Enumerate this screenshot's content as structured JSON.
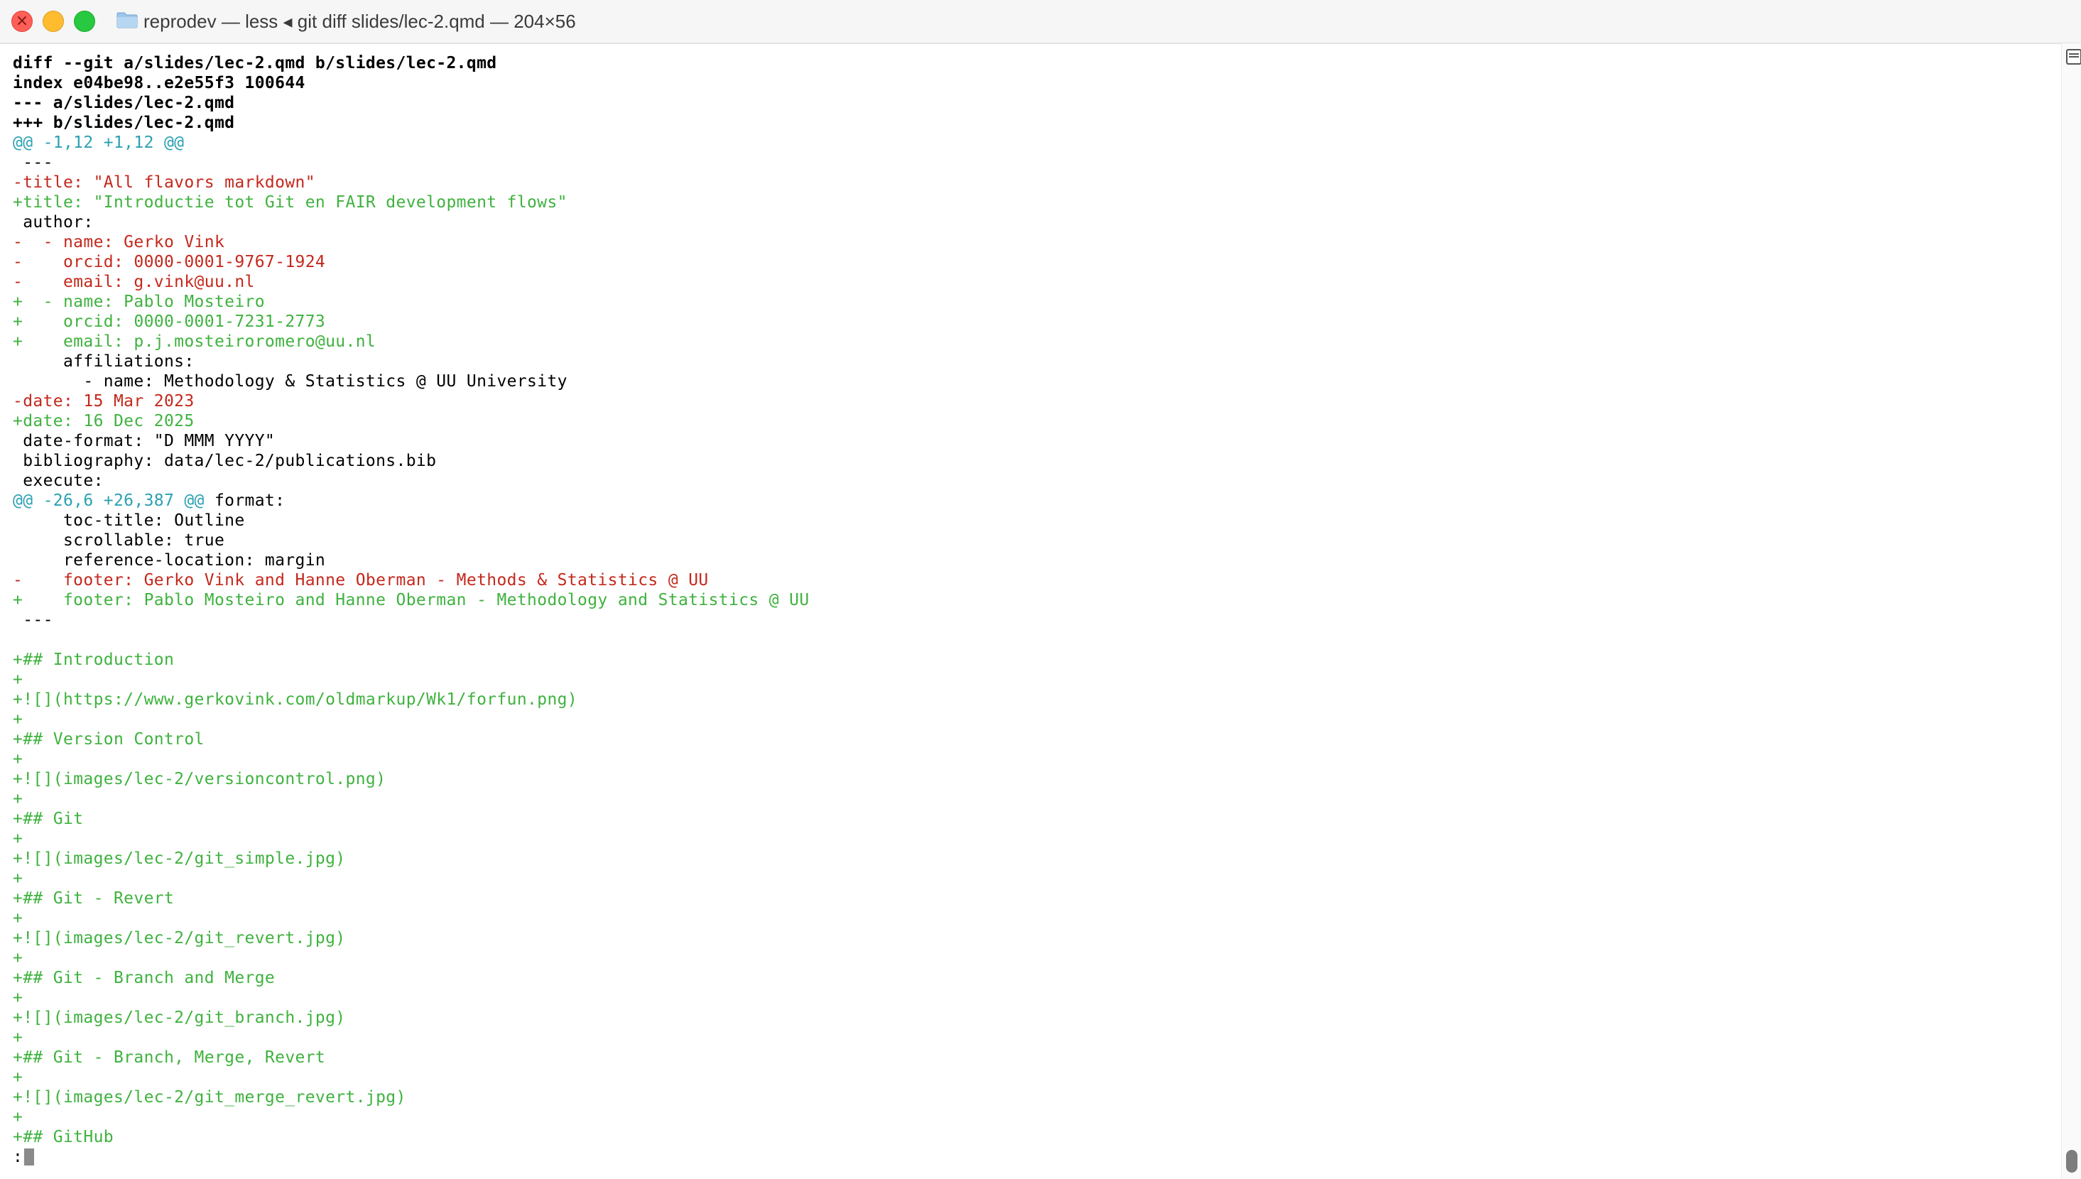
{
  "window": {
    "title": "reprodev — less ◂ git diff slides/lec-2.qmd — 204×56"
  },
  "diff": {
    "lines": [
      {
        "kind": "meta",
        "text": "diff --git a/slides/lec-2.qmd b/slides/lec-2.qmd"
      },
      {
        "kind": "meta",
        "text": "index e04be98..e2e55f3 100644"
      },
      {
        "kind": "meta",
        "text": "--- a/slides/lec-2.qmd"
      },
      {
        "kind": "meta",
        "text": "+++ b/slides/lec-2.qmd"
      },
      {
        "kind": "hunk",
        "text": "@@ -1,12 +1,12 @@"
      },
      {
        "kind": "ctx",
        "text": " ---"
      },
      {
        "kind": "del",
        "text": "-title: \"All flavors markdown\""
      },
      {
        "kind": "add",
        "text": "+title: \"Introductie tot Git en FAIR development flows\""
      },
      {
        "kind": "ctx",
        "text": " author:"
      },
      {
        "kind": "del",
        "text": "-  - name: Gerko Vink"
      },
      {
        "kind": "del",
        "text": "-    orcid: 0000-0001-9767-1924"
      },
      {
        "kind": "del",
        "text": "-    email: g.vink@uu.nl"
      },
      {
        "kind": "add",
        "text": "+  - name: Pablo Mosteiro"
      },
      {
        "kind": "add",
        "text": "+    orcid: 0000-0001-7231-2773"
      },
      {
        "kind": "add",
        "text": "+    email: p.j.mosteiroromero@uu.nl"
      },
      {
        "kind": "ctx",
        "text": "     affiliations:"
      },
      {
        "kind": "ctx",
        "text": "       - name: Methodology & Statistics @ UU University"
      },
      {
        "kind": "del",
        "text": "-date: 15 Mar 2023"
      },
      {
        "kind": "add",
        "text": "+date: 16 Dec 2025"
      },
      {
        "kind": "ctx",
        "text": " date-format: \"D MMM YYYY\""
      },
      {
        "kind": "ctx",
        "text": " bibliography: data/lec-2/publications.bib"
      },
      {
        "kind": "ctx",
        "text": " execute:"
      },
      {
        "kind": "hunkctx",
        "hunk": "@@ -26,6 +26,387 @@",
        "text": " format:"
      },
      {
        "kind": "ctx",
        "text": "     toc-title: Outline"
      },
      {
        "kind": "ctx",
        "text": "     scrollable: true"
      },
      {
        "kind": "ctx",
        "text": "     reference-location: margin"
      },
      {
        "kind": "del",
        "text": "-    footer: Gerko Vink and Hanne Oberman - Methods & Statistics @ UU"
      },
      {
        "kind": "add",
        "text": "+    footer: Pablo Mosteiro and Hanne Oberman - Methodology and Statistics @ UU"
      },
      {
        "kind": "ctx",
        "text": " ---"
      },
      {
        "kind": "ctx",
        "text": ""
      },
      {
        "kind": "add",
        "text": "+## Introduction"
      },
      {
        "kind": "add",
        "text": "+"
      },
      {
        "kind": "add",
        "text": "+![](https://www.gerkovink.com/oldmarkup/Wk1/forfun.png)"
      },
      {
        "kind": "add",
        "text": "+"
      },
      {
        "kind": "add",
        "text": "+## Version Control"
      },
      {
        "kind": "add",
        "text": "+"
      },
      {
        "kind": "add",
        "text": "+![](images/lec-2/versioncontrol.png)"
      },
      {
        "kind": "add",
        "text": "+"
      },
      {
        "kind": "add",
        "text": "+## Git"
      },
      {
        "kind": "add",
        "text": "+"
      },
      {
        "kind": "add",
        "text": "+![](images/lec-2/git_simple.jpg)"
      },
      {
        "kind": "add",
        "text": "+"
      },
      {
        "kind": "add",
        "text": "+## Git - Revert"
      },
      {
        "kind": "add",
        "text": "+"
      },
      {
        "kind": "add",
        "text": "+![](images/lec-2/git_revert.jpg)"
      },
      {
        "kind": "add",
        "text": "+"
      },
      {
        "kind": "add",
        "text": "+## Git - Branch and Merge"
      },
      {
        "kind": "add",
        "text": "+"
      },
      {
        "kind": "add",
        "text": "+![](images/lec-2/git_branch.jpg)"
      },
      {
        "kind": "add",
        "text": "+"
      },
      {
        "kind": "add",
        "text": "+## Git - Branch, Merge, Revert"
      },
      {
        "kind": "add",
        "text": "+"
      },
      {
        "kind": "add",
        "text": "+![](images/lec-2/git_merge_revert.jpg)"
      },
      {
        "kind": "add",
        "text": "+"
      },
      {
        "kind": "add",
        "text": "+## GitHub"
      }
    ],
    "prompt": ":"
  },
  "colors": {
    "added": "#3fb23f",
    "removed": "#c4281c",
    "hunk": "#2aa1b3",
    "context": "#000000"
  },
  "icons": [
    "close-button",
    "minimize-button",
    "zoom-button",
    "folder-icon",
    "scrollbar-menu-icon"
  ]
}
